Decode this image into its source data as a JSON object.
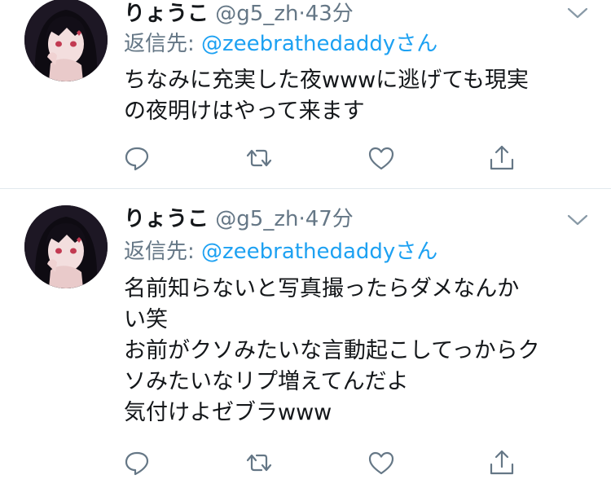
{
  "tweets": [
    {
      "display_name": "りょうこ",
      "handle": "@g5_zh",
      "separator": "·",
      "time": "43分",
      "reply_prefix": "返信先: ",
      "reply_mention": "@zeebrathedaddy",
      "reply_suffix": "さん",
      "lines": [
        "ちなみに充実した夜wwwに逃げても現実",
        "の夜明けはやって来ます"
      ],
      "actions": {
        "reply": "reply-icon",
        "retweet": "retweet-icon",
        "like": "heart-icon",
        "share": "share-icon"
      }
    },
    {
      "display_name": "りょうこ",
      "handle": "@g5_zh",
      "separator": "·",
      "time": "47分",
      "reply_prefix": "返信先: ",
      "reply_mention": "@zeebrathedaddy",
      "reply_suffix": "さん",
      "lines": [
        "名前知らないと写真撮ったらダメなんか",
        "い笑",
        "お前がクソみたいな言動起こしてっからク",
        "ソみたいなリプ増えてんだよ",
        "気付けよゼブラwww"
      ],
      "actions": {
        "reply": "reply-icon",
        "retweet": "retweet-icon",
        "like": "heart-icon",
        "share": "share-icon"
      }
    }
  ],
  "colors": {
    "link": "#1da1f2",
    "muted": "#657786",
    "text": "#14171a",
    "divider": "#e1e8ed"
  }
}
